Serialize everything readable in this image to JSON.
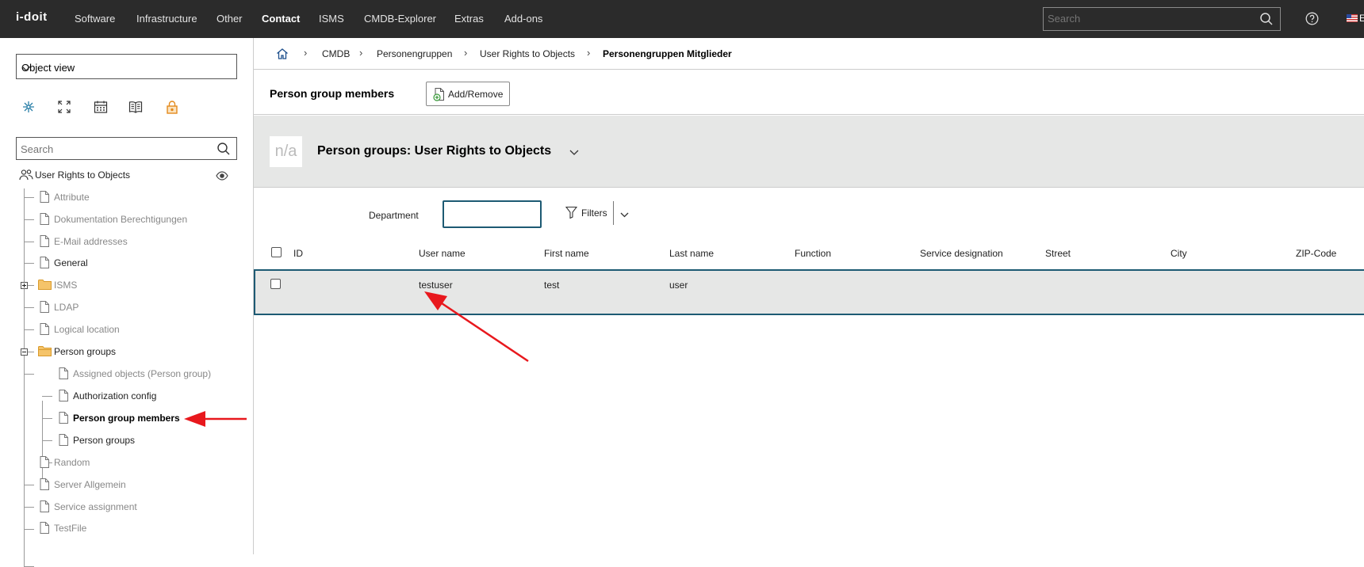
{
  "app": {
    "logo": "i-doit"
  },
  "nav": {
    "items": [
      {
        "label": "Software"
      },
      {
        "label": "Infrastructure"
      },
      {
        "label": "Other"
      },
      {
        "label": "Contact",
        "active": true
      },
      {
        "label": "ISMS"
      },
      {
        "label": "CMDB-Explorer"
      },
      {
        "label": "Extras"
      },
      {
        "label": "Add-ons"
      }
    ],
    "search_placeholder": "Search",
    "lang_stub": "E"
  },
  "sidebar": {
    "view_select": "Object view",
    "search_placeholder": "Search",
    "tools": [
      "network-icon",
      "fullscreen-icon",
      "calendar-icon",
      "book-icon",
      "lock-icon"
    ],
    "root": "User Rights to Objects",
    "items": [
      {
        "label": "Attribute"
      },
      {
        "label": "Dokumentation Berechtigungen"
      },
      {
        "label": "E-Mail addresses"
      },
      {
        "label": "General"
      },
      {
        "label": "ISMS"
      },
      {
        "label": "LDAP"
      },
      {
        "label": "Logical location"
      },
      {
        "label": "Person groups"
      },
      {
        "label": "Random"
      },
      {
        "label": "Server Allgemein"
      },
      {
        "label": "Service assignment"
      },
      {
        "label": "TestFile"
      }
    ],
    "children": [
      {
        "label": "Assigned objects (Person group)"
      },
      {
        "label": "Authorization config"
      },
      {
        "label": "Person group members"
      },
      {
        "label": "Person groups"
      }
    ]
  },
  "breadcrumb": [
    "CMDB",
    "Personengruppen",
    "User Rights to Objects",
    "Personengruppen Mitglieder"
  ],
  "category": {
    "title": "Person group members",
    "add_remove_label": "Add/Remove"
  },
  "object": {
    "image_placeholder": "n/a",
    "title": "Person groups: User Rights to Objects"
  },
  "filter": {
    "department_label": "Department",
    "department_value": "",
    "filters_label": "Filters"
  },
  "table": {
    "columns": [
      "ID",
      "User name",
      "First name",
      "Last name",
      "Function",
      "Service designation",
      "Street",
      "City",
      "ZIP-Code"
    ],
    "rows": [
      {
        "id": "",
        "user_name": "testuser",
        "first_name": "test",
        "last_name": "user",
        "function": "",
        "service_designation": "",
        "street": "",
        "city": "",
        "zip": ""
      }
    ]
  },
  "colors": {
    "topbar": "#2b2b2b",
    "accent": "#1d5a73",
    "highlight_row": "#e6e7e6",
    "annotation_arrow": "#e8181d",
    "folder": "#f0b948"
  }
}
